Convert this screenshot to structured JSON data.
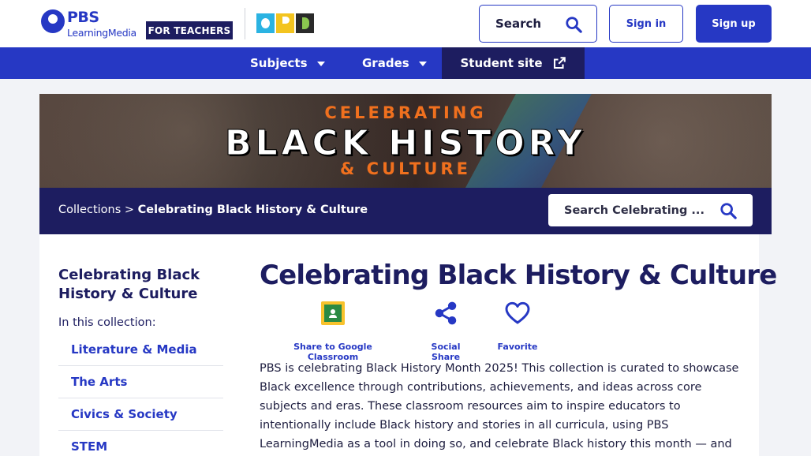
{
  "header": {
    "brand_top": "PBS",
    "brand_sub": "LearningMedia",
    "audience_badge": "FOR TEACHERS",
    "partner_logo": "OPB",
    "search_label": "Search",
    "signin_label": "Sign in",
    "signup_label": "Sign up"
  },
  "nav": {
    "subjects_label": "Subjects",
    "grades_label": "Grades",
    "student_site_label": "Student site"
  },
  "banner": {
    "line1": "CELEBRATING",
    "line2": "BLACK HISTORY",
    "line3": "& CULTURE"
  },
  "breadcrumb": {
    "root": "Collections",
    "separator": " > ",
    "current": "Celebrating Black History & Culture"
  },
  "collection_search": {
    "placeholder": "Search Celebrating ..."
  },
  "sidebar": {
    "title": "Celebrating Black History & Culture",
    "subtitle": "In this collection:",
    "items": [
      {
        "label": "Literature & Media"
      },
      {
        "label": "The Arts"
      },
      {
        "label": "Civics & Society"
      },
      {
        "label": "STEM"
      }
    ]
  },
  "main": {
    "title": "Celebrating Black History & Culture",
    "actions": {
      "classroom_label": "Share to Google Classroom",
      "social_label": "Social Share",
      "favorite_label": "Favorite"
    },
    "description": "PBS is celebrating Black History Month 2025! This collection is curated to showcase Black excellence through contributions, achievements, and ideas across core subjects and eras. These classroom resources aim to inspire educators to intentionally include Black history and stories in all curricula, using PBS LearningMedia as a tool in doing so, and celebrate Black history this month — and"
  },
  "colors": {
    "brand_blue": "#2638c4",
    "navy": "#1d1d60",
    "accent_orange": "#f0701e",
    "page_bg": "#f2f3f7"
  }
}
